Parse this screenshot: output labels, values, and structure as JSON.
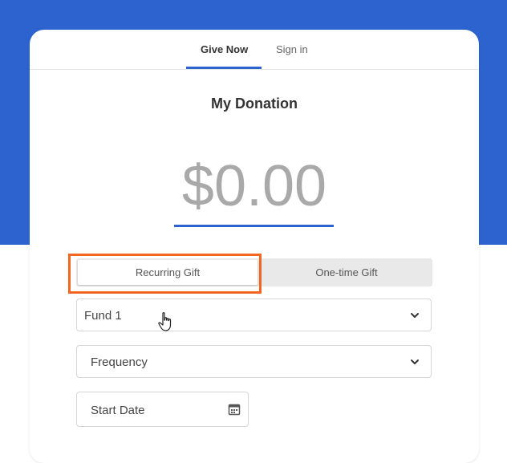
{
  "tabs": [
    {
      "label": "Give Now",
      "active": true
    },
    {
      "label": "Sign in",
      "active": false
    }
  ],
  "donation": {
    "title": "My Donation",
    "amount": "$0.00"
  },
  "gift_type": {
    "options": [
      "Recurring Gift",
      "One-time Gift"
    ],
    "selected": "Recurring Gift"
  },
  "fields": {
    "fund": {
      "value": "Fund 1",
      "icon": "chevron-down-icon"
    },
    "frequency": {
      "placeholder": "Frequency",
      "icon": "chevron-down-icon"
    },
    "start_date": {
      "placeholder": "Start Date",
      "icon": "calendar-icon"
    }
  },
  "colors": {
    "brand_blue": "#2d63cf",
    "highlight": "#f26522",
    "amount_text": "#a9a9a9"
  }
}
